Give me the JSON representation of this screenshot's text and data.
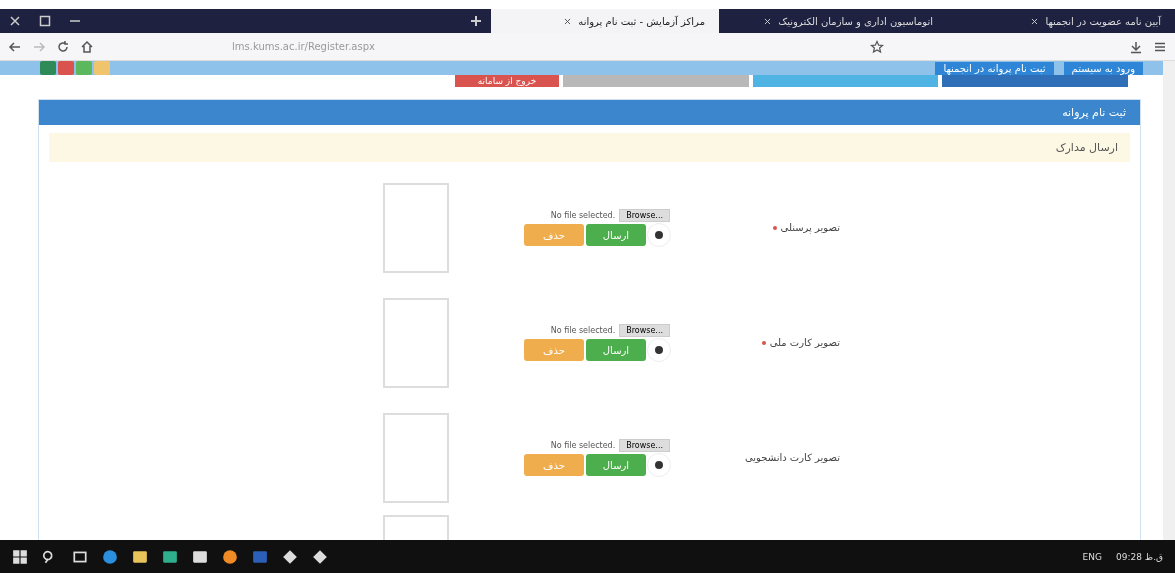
{
  "browser": {
    "tabs": [
      {
        "title": "آیین نامه عضویت در انجمنها",
        "selected": false
      },
      {
        "title": "اتوماسیون اداری و سازمان الکترونیک",
        "selected": false
      },
      {
        "title": "مراکز آزمایش - ثبت نام پروانه",
        "selected": true
      }
    ],
    "url": "lms.kums.ac.ir/Register.aspx"
  },
  "top_bar": {
    "links": [
      "ورود به سیستم",
      "ثبت نام پروانه در انجمنها"
    ],
    "menu": [
      {
        "color": "#2f6fb7"
      },
      {
        "color": "#4fb3e3"
      },
      {
        "color": "#b8b8b8"
      },
      {
        "color": "#d9534f",
        "label": "خروج از سامانه"
      }
    ],
    "quick_buttons": [
      {
        "color": "#2e8b57"
      },
      {
        "color": "#d9534f"
      },
      {
        "color": "#5cb85c"
      },
      {
        "color": "#f0c36d"
      }
    ]
  },
  "panel": {
    "title": "ثبت نام پروانه",
    "section": "ارسال مدارک",
    "rows": [
      {
        "label": "تصویر پرسنلی",
        "required": true,
        "file_status": "No file selected.",
        "browse": "Browse...",
        "send": "ارسال",
        "delete": "حذف"
      },
      {
        "label": "تصویر کارت ملی",
        "required": true,
        "file_status": "No file selected.",
        "browse": "Browse...",
        "send": "ارسال",
        "delete": "حذف"
      },
      {
        "label": "تصویر کارت دانشجویی",
        "required": false,
        "file_status": "No file selected.",
        "browse": "Browse...",
        "send": "ارسال",
        "delete": "حذف"
      }
    ]
  },
  "taskbar": {
    "language": "ENG",
    "time": "09:28 ق.ظ"
  }
}
